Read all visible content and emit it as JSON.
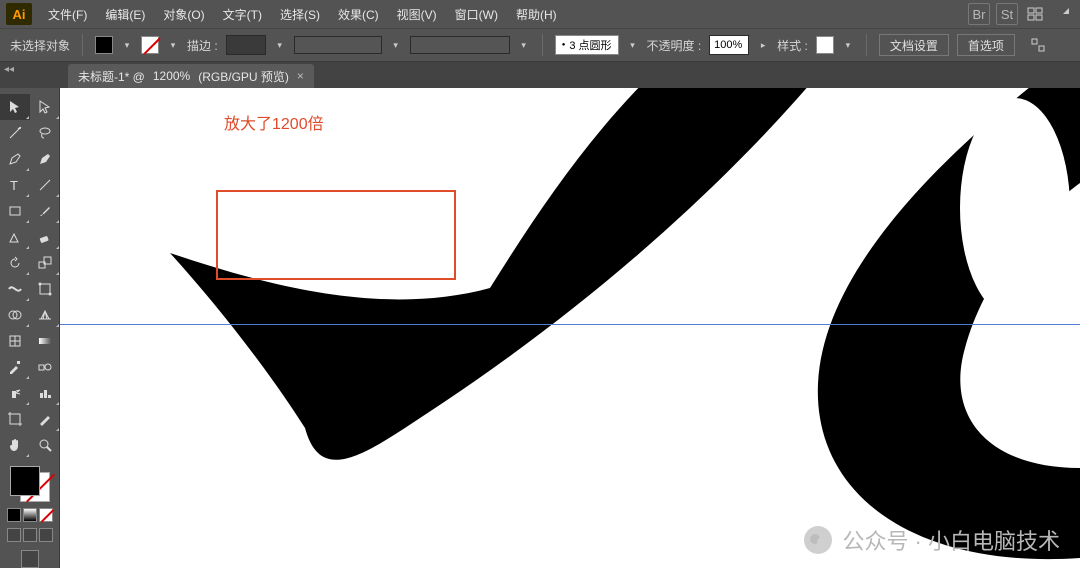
{
  "app": {
    "logo": "Ai"
  },
  "menus": {
    "file": "文件(F)",
    "edit": "编辑(E)",
    "object": "对象(O)",
    "type": "文字(T)",
    "select": "选择(S)",
    "effect": "效果(C)",
    "view": "视图(V)",
    "window": "窗口(W)",
    "help": "帮助(H)"
  },
  "menu_icons": {
    "br": "Br",
    "st": "St"
  },
  "control": {
    "no_selection": "未选择对象",
    "stroke_label": "描边 :",
    "stroke_value": "",
    "brush_combo": "3 点圆形",
    "opacity_label": "不透明度 :",
    "opacity_value": "100%",
    "style_label": "样式 :",
    "doc_setup": "文档设置",
    "prefs": "首选项"
  },
  "tab": {
    "title_prefix": "未标题-1* @ ",
    "zoom": "1200%",
    "title_suffix": " (RGB/GPU 预览)"
  },
  "annotation": {
    "text": "放大了1200倍"
  },
  "watermark": {
    "text": "公众号 · 小白电脑技术"
  }
}
